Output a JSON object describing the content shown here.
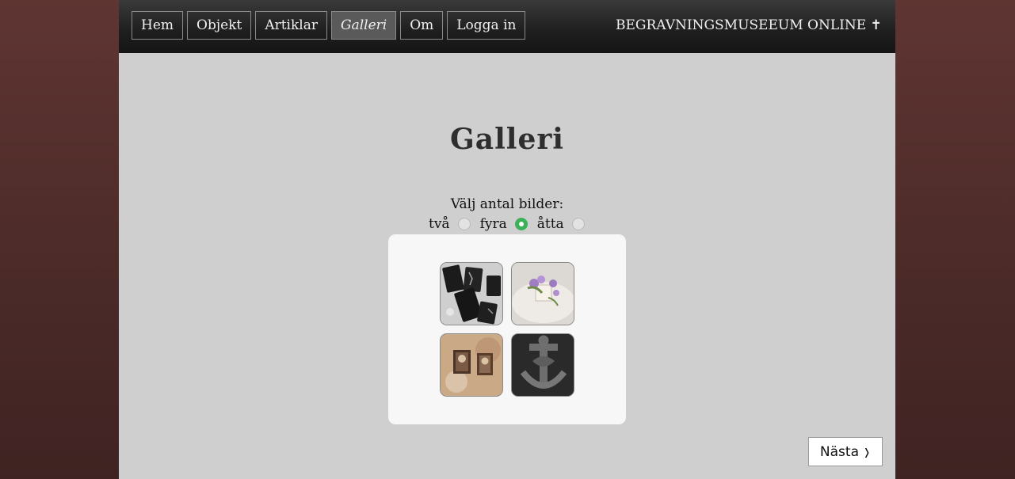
{
  "nav": {
    "items": [
      {
        "label": "Hem"
      },
      {
        "label": "Objekt"
      },
      {
        "label": "Artiklar"
      },
      {
        "label": "Galleri",
        "active": true
      },
      {
        "label": "Om"
      },
      {
        "label": "Logga in"
      }
    ]
  },
  "site_title": "BEGRAVNINGSMUSEEUM ONLINE ✝",
  "page_title": "Galleri",
  "count_selector": {
    "label": "Välj antal bilder:",
    "options": [
      "två",
      "fyra",
      "åtta"
    ],
    "selected": "fyra"
  },
  "gallery": {
    "images": [
      "image-1",
      "image-2",
      "image-3",
      "image-4"
    ]
  },
  "next_button": {
    "label": "Nästa",
    "icon": "chevron-right-icon"
  },
  "colors": {
    "accent_radio": "#3db05a",
    "topbar": "#1e1e1e",
    "page_bg": "#cfcfcf",
    "body_bg": "#4a2a28"
  }
}
